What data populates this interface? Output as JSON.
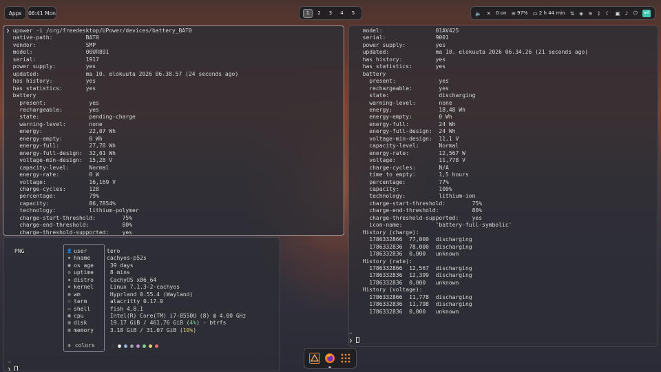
{
  "topbar": {
    "apps_label": "Apps",
    "clock": "06:41 Mon",
    "workspaces": [
      "1",
      "2",
      "3",
      "4",
      "5"
    ],
    "active_workspace": "1",
    "tray": {
      "speaker_icon": "speaker-icon",
      "mic_icon": "mic-muted-icon",
      "bluetooth_status": "0 on",
      "wifi_icon": "wifi-icon",
      "battery_percent": "97%",
      "battery_time": "2 h 44 min",
      "icons": [
        "network-icon",
        "layers-icon",
        "wifi-icon",
        "bluetooth-icon",
        "moon-icon",
        "lock-icon",
        "bell-icon",
        "power-icon"
      ],
      "badge_text": "wifi",
      "badge_color": "#3ec6b0"
    }
  },
  "terminal_left": {
    "prompt": "❯",
    "command": "upower -i /org/freedesktop/UPower/devices/battery_BAT0",
    "lines": [
      "  native-path:          BAT0",
      "  vendor:               SMP",
      "  model:                00UR891",
      "  serial:               1917",
      "  power supply:         yes",
      "  updated:              ma 10. elokuuta 2026 06.38.57 (24 seconds ago)",
      "  has history:          yes",
      "  has statistics:       yes",
      "  battery",
      "    present:             yes",
      "    rechargeable:        yes",
      "    state:               pending-charge",
      "    warning-level:       none",
      "    energy:              22,07 Wh",
      "    energy-empty:        0 Wh",
      "    energy-full:         27,78 Wh",
      "    energy-full-design:  32,01 Wh",
      "    voltage-min-design:  15,28 V",
      "    capacity-level:      Normal",
      "    energy-rate:         0 W",
      "    voltage:             16,169 V",
      "    charge-cycles:       128",
      "    percentage:          79%",
      "    capacity:            86,7854%",
      "    technology:          lithium-polymer",
      "    charge-start-threshold:        75%",
      "    charge-end-threshold:          80%",
      "    charge-threshold-supported:    yes"
    ]
  },
  "terminal_right": {
    "lines": [
      "  model:                01AV425",
      "  serial:               9001",
      "  power supply:         yes",
      "  updated:              ma 10. elokuuta 2026 06.34.26 (21 seconds ago)",
      "  has history:          yes",
      "  has statistics:       yes",
      "  battery",
      "    present:             yes",
      "    rechargeable:        yes",
      "    state:               discharging",
      "    warning-level:       none",
      "    energy:              18,48 Wh",
      "    energy-empty:        0 Wh",
      "    energy-full:         24 Wh",
      "    energy-full-design:  24 Wh",
      "    voltage-min-design:  11,1 V",
      "    capacity-level:      Normal",
      "    energy-rate:         12,567 W",
      "    voltage:             11,778 V",
      "    charge-cycles:       N/A",
      "    time to empty:       1,5 hours",
      "    percentage:          77%",
      "    capacity:            100%",
      "    technology:          lithium-ion",
      "    charge-start-threshold:        75%",
      "    charge-end-threshold:          80%",
      "    charge-threshold-supported:    yes",
      "    icon-name:          'battery-full-symbolic'",
      "  History (charge):",
      "    1786332866  77,000  discharging",
      "    1786332836  78,000  discharging",
      "    1786332836  0,000   unknown",
      "  History (rate):",
      "    1786332866  12,567  discharging",
      "    1786332836  12,399  discharging",
      "    1786332836  0,000   unknown",
      "  History (voltage):",
      "    1786332866  11,778  discharging",
      "    1786332836  11,798  discharging",
      "    1786332836  0,000   unknown"
    ],
    "prompt_tilde": "~",
    "prompt_sym": "❯"
  },
  "fastfetch": {
    "logo_text": "PNG",
    "rows": [
      {
        "icon": "user-icon",
        "glyph": "👤",
        "key": "user",
        "value": "tero"
      },
      {
        "icon": "hname-icon",
        "glyph": "▪",
        "key": "hname",
        "value": "cachyos-p52s"
      },
      {
        "icon": "os-age-icon",
        "glyph": "▣",
        "key": "os age",
        "value": " 39 days"
      },
      {
        "icon": "uptime-icon",
        "glyph": "◷",
        "key": "uptime",
        "value": " 8 mins"
      },
      {
        "icon": "distro-icon",
        "glyph": "◈",
        "key": "distro",
        "value": " CachyOS x86_64"
      },
      {
        "icon": "kernel-icon",
        "glyph": "⚙",
        "key": "kernel",
        "value": " Linux 7.1.3-2-cachyos"
      },
      {
        "icon": "wm-icon",
        "glyph": "▤",
        "key": "wm",
        "value": " Hyprland 0.55.4 (Wayland)"
      },
      {
        "icon": "term-icon",
        "glyph": "▭",
        "key": "term",
        "value": " alacritty 0.17.0"
      },
      {
        "icon": "shell-icon",
        "glyph": "▭",
        "key": "shell",
        "value": " fish 4.8.1"
      },
      {
        "icon": "cpu-icon",
        "glyph": "▦",
        "key": "cpu",
        "value": " Intel(R) Core(TM) i7-8550U (8) @ 4.00 GHz"
      },
      {
        "icon": "disk-icon",
        "glyph": "▥",
        "key": "disk",
        "value_prefix": " 19.17 GiB / 461.76 GiB (",
        "value_pct": "4%",
        "value_suffix": ") - btrfs"
      },
      {
        "icon": "memory-icon",
        "glyph": "▥",
        "key": "memory",
        "value_prefix": " 3.18 GiB / 31.07 GiB (",
        "value_pct": "10%",
        "value_suffix": ")"
      }
    ],
    "colors_label": "colors",
    "colors_icon": "palette-icon",
    "palette": [
      "#3a3a3a",
      "#e8e8e8",
      "#8fb6e0",
      "#9aa0a8",
      "#c58ad6",
      "#7fd08a",
      "#e6cf6e",
      "#e07070"
    ],
    "prompt_tilde": "~",
    "prompt_sym": "❯"
  },
  "dock": {
    "apps": [
      "inkscape-icon",
      "firefox-icon",
      "app-grid-icon"
    ]
  }
}
